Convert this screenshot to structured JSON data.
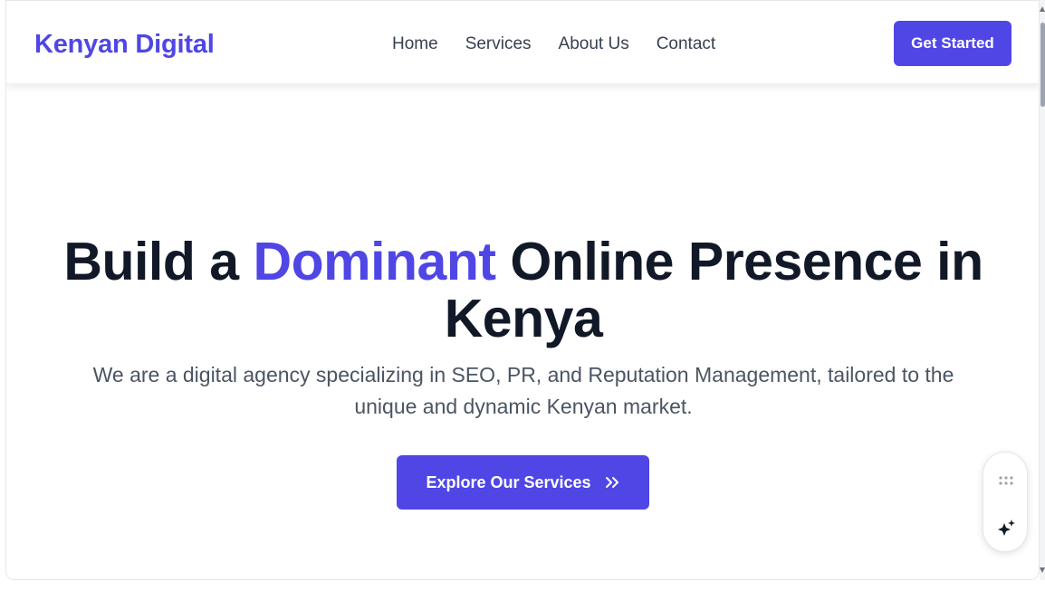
{
  "header": {
    "brand": "Kenyan Digital",
    "nav": [
      "Home",
      "Services",
      "About Us",
      "Contact"
    ],
    "cta": "Get Started"
  },
  "hero": {
    "title_before": "Build a ",
    "title_accent": "Dominant",
    "title_after": " Online Presence in Kenya",
    "subtitle": "We are a digital agency specializing in SEO, PR, and Reputation Management, tailored to the unique and dynamic Kenyan market.",
    "cta": "Explore Our Services"
  },
  "icons": {
    "cta_arrow": "double-chevron-right-icon",
    "widget_grip": "grip-dots-icon",
    "widget_ai": "sparkle-icon"
  },
  "colors": {
    "accent": "#4f46e5",
    "heading": "#111827",
    "body_text": "#4b5563",
    "nav_text": "#374151"
  }
}
